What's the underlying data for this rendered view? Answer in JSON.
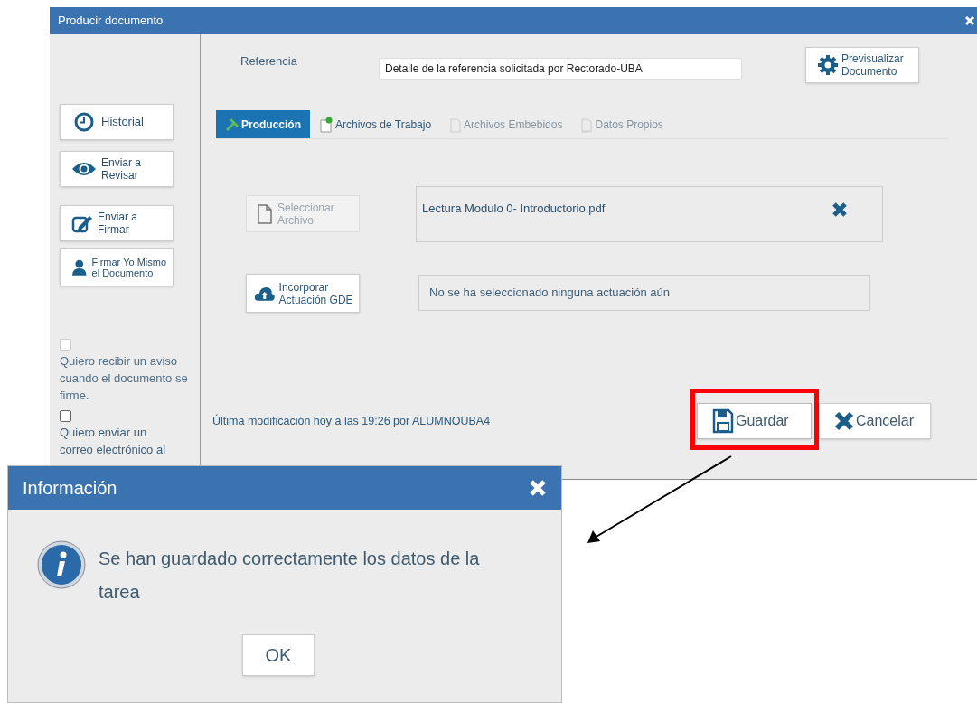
{
  "window": {
    "title": "Producir documento"
  },
  "sidebar": {
    "buttons": [
      {
        "kind": "history",
        "label": "Historial"
      },
      {
        "kind": "review",
        "label": "Enviar a Revisar"
      },
      {
        "kind": "sign",
        "label": "Enviar a Firmar"
      },
      {
        "kind": "self_sign",
        "label": "Firmar Yo Mismo el Documento"
      }
    ],
    "options": [
      {
        "label": "Quiero recibir un aviso cuando el documento se firme.",
        "checked": false,
        "disabled": true
      },
      {
        "label": "Quiero enviar un correo electrónico al",
        "checked": false,
        "disabled": false
      }
    ]
  },
  "reference": {
    "label": "Referencia",
    "value": "Detalle de la referencia solicitada por Rectorado-UBA"
  },
  "preview_button": {
    "label": "Previsualizar Documento"
  },
  "tabs": [
    {
      "kind": "production",
      "label": "Producción",
      "selected": true,
      "disabled": false
    },
    {
      "kind": "work_files",
      "label": "Archivos de Trabajo",
      "selected": false,
      "disabled": false
    },
    {
      "kind": "embedded",
      "label": "Archivos Embebidos",
      "selected": false,
      "disabled": true
    },
    {
      "kind": "own_data",
      "label": "Datos Propios",
      "selected": false,
      "disabled": true
    }
  ],
  "file": {
    "button": "Seleccionar Archivo",
    "disabled": true,
    "file_name": "Lectura Modulo 0- Introductorio.pdf"
  },
  "gde": {
    "button": "Incorporar Actuación GDE",
    "status": "No se ha seleccionado ninguna actuación aún"
  },
  "last_modified": "Última modificación hoy a las 19:26 por ALUMNOUBA4",
  "actions": [
    {
      "kind": "save",
      "label": "Guardar",
      "highlighted": true
    },
    {
      "kind": "cancel",
      "label": "Cancelar",
      "highlighted": false
    }
  ],
  "dialog": {
    "title": "Información",
    "message": "Se han guardado correctamente los datos de la tarea",
    "button": "OK"
  }
}
